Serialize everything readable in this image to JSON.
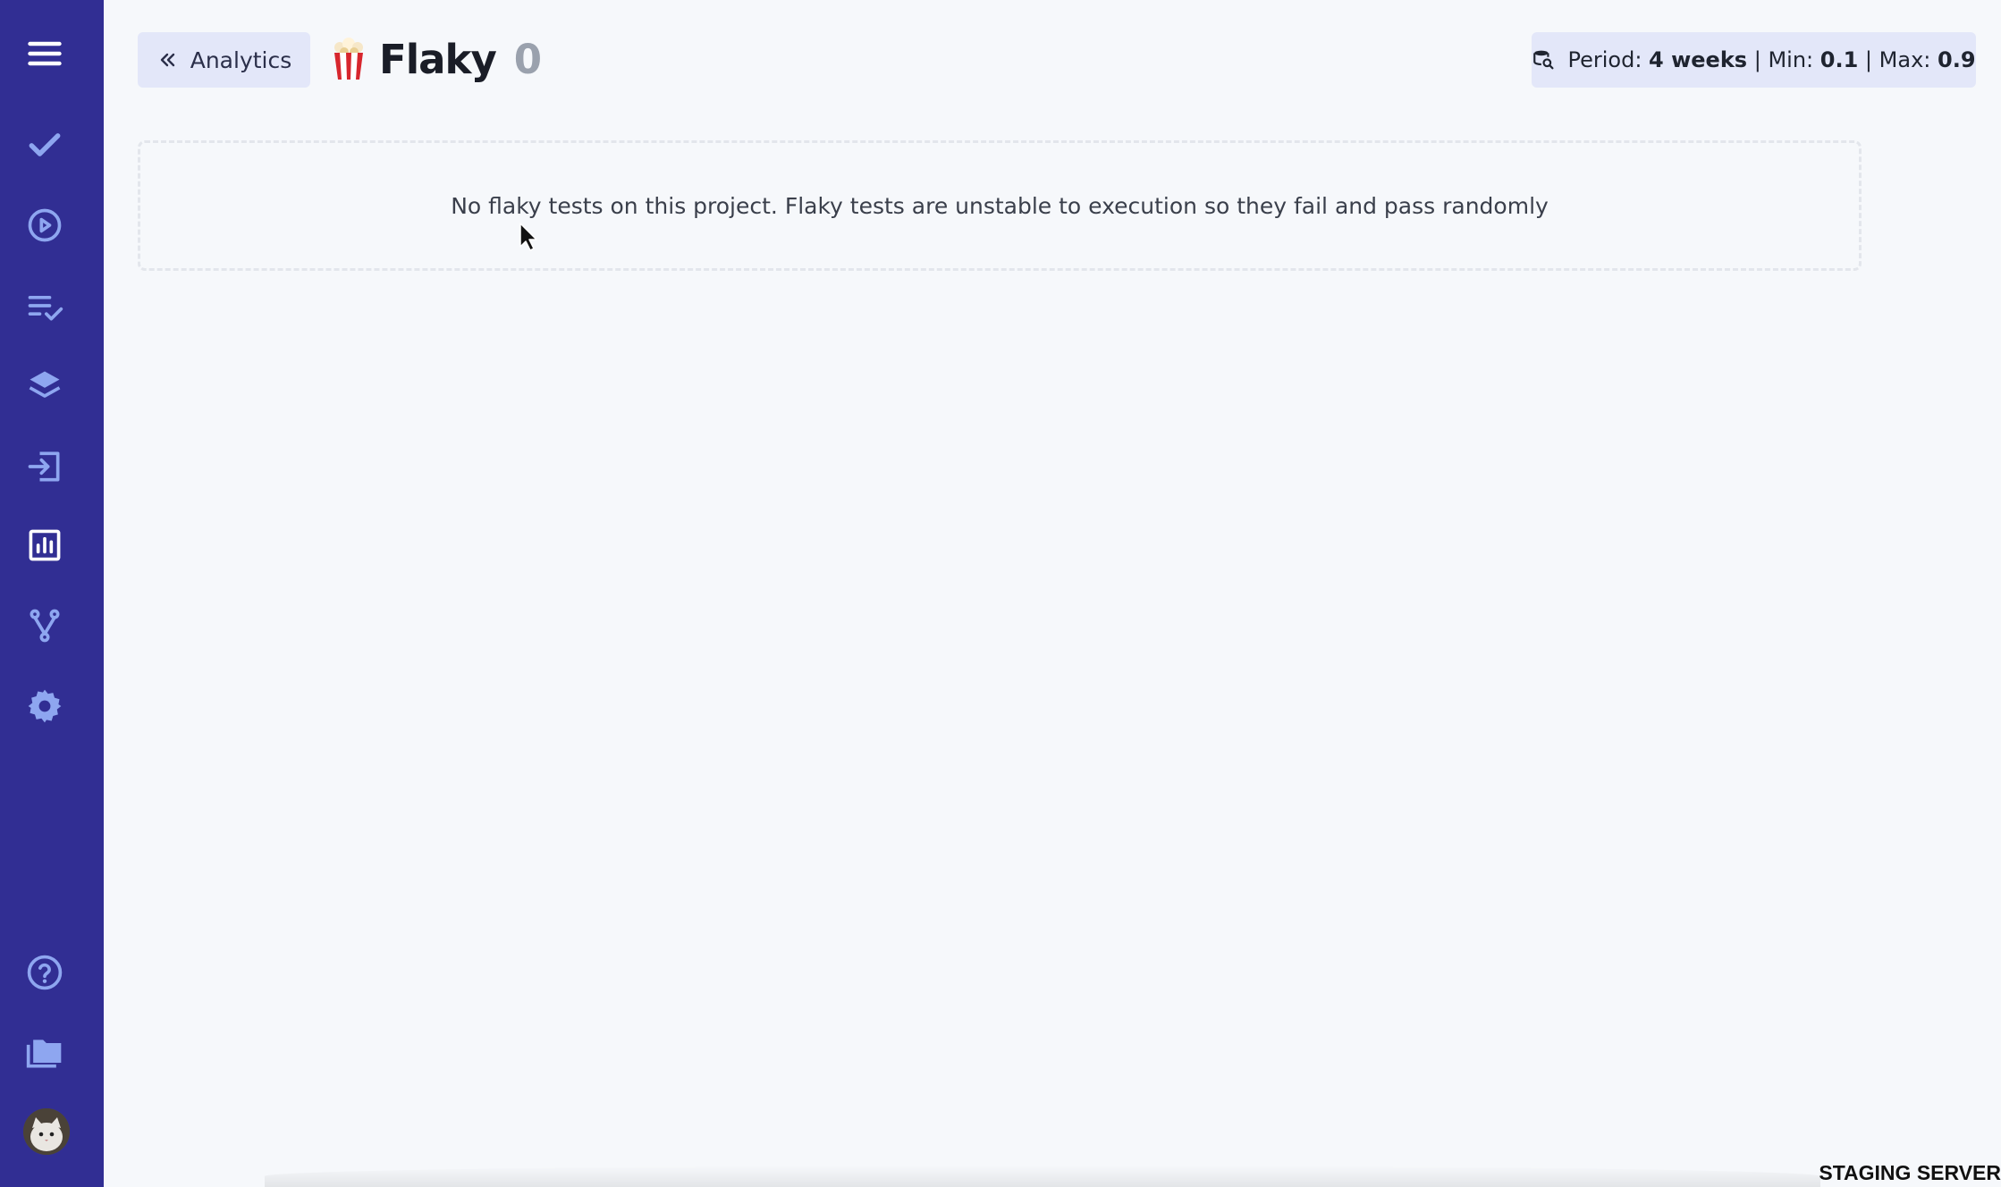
{
  "header": {
    "back_label": "Analytics",
    "title": "Flaky",
    "count": "0",
    "period": {
      "period_label": "Period:",
      "period_value": "4 weeks",
      "min_label": "Min:",
      "min_value": "0.1",
      "max_label": "Max:",
      "max_value": "0.9",
      "sep": "|"
    }
  },
  "empty_message": "No flaky tests on this project. Flaky tests are unstable to execution so they fail and pass randomly",
  "footer_badge": "STAGING SERVER",
  "colors": {
    "sidebar": "#312e93",
    "icon": "#8ea6f0",
    "button_bg": "#e3e7f9",
    "page_bg": "#f6f8fb"
  },
  "sidebar": {
    "items": [
      {
        "icon": "menu-icon"
      },
      {
        "icon": "check-icon"
      },
      {
        "icon": "play-circle-icon"
      },
      {
        "icon": "checklist-icon"
      },
      {
        "icon": "layers-icon"
      },
      {
        "icon": "import-icon"
      },
      {
        "icon": "analytics-icon"
      },
      {
        "icon": "branch-icon"
      },
      {
        "icon": "settings-icon"
      },
      {
        "icon": "help-icon"
      },
      {
        "icon": "projects-icon"
      },
      {
        "icon": "avatar"
      }
    ]
  }
}
